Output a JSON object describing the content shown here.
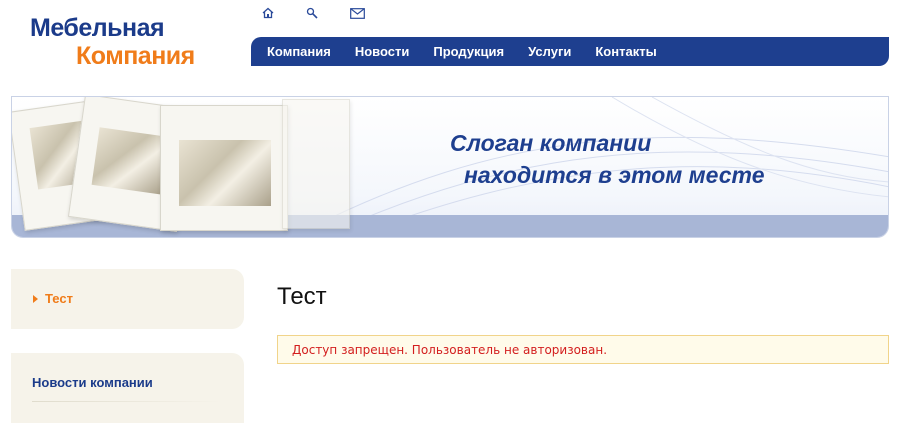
{
  "logo": {
    "line1": "Мебельная",
    "line2": "Компания"
  },
  "top_icons": [
    "home-icon",
    "search-icon",
    "mail-icon"
  ],
  "nav": {
    "items": [
      "Компания",
      "Новости",
      "Продукция",
      "Услуги",
      "Контакты"
    ]
  },
  "banner": {
    "slogan_line1": "Слоган компании",
    "slogan_line2": "находится в этом месте"
  },
  "sidebar": {
    "menu_item": "Тест",
    "news_title": "Новости компании"
  },
  "main": {
    "title": "Тест",
    "alert": "Доступ запрещен. Пользователь не авторизован."
  },
  "colors": {
    "brand_blue": "#1e3f8f",
    "brand_orange": "#f07c1a",
    "alert_text": "#d31e1e"
  }
}
